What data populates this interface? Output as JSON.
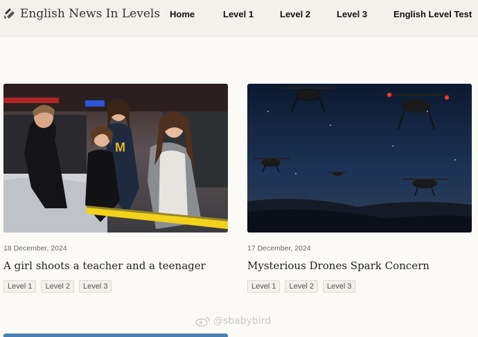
{
  "header": {
    "logo_text": "English News In Levels",
    "nav": [
      {
        "label": "Home"
      },
      {
        "label": "Level 1"
      },
      {
        "label": "Level 2"
      },
      {
        "label": "Level 3"
      },
      {
        "label": "English Level Test"
      }
    ]
  },
  "articles": [
    {
      "date": "18 December, 2024",
      "title": "A girl shoots a teacher and a teenager",
      "tags": [
        "Level 1",
        "Level 2",
        "Level 3"
      ]
    },
    {
      "date": "17 December, 2024",
      "title": "Mysterious Drones Spark Concern",
      "tags": [
        "Level 1",
        "Level 2",
        "Level 3"
      ]
    }
  ],
  "watermark": {
    "text": "@sbabybird"
  },
  "colors": {
    "header_bg": "#f3f1ec",
    "page_bg": "#fbfaf7",
    "police_tape": "#f2d21b"
  }
}
